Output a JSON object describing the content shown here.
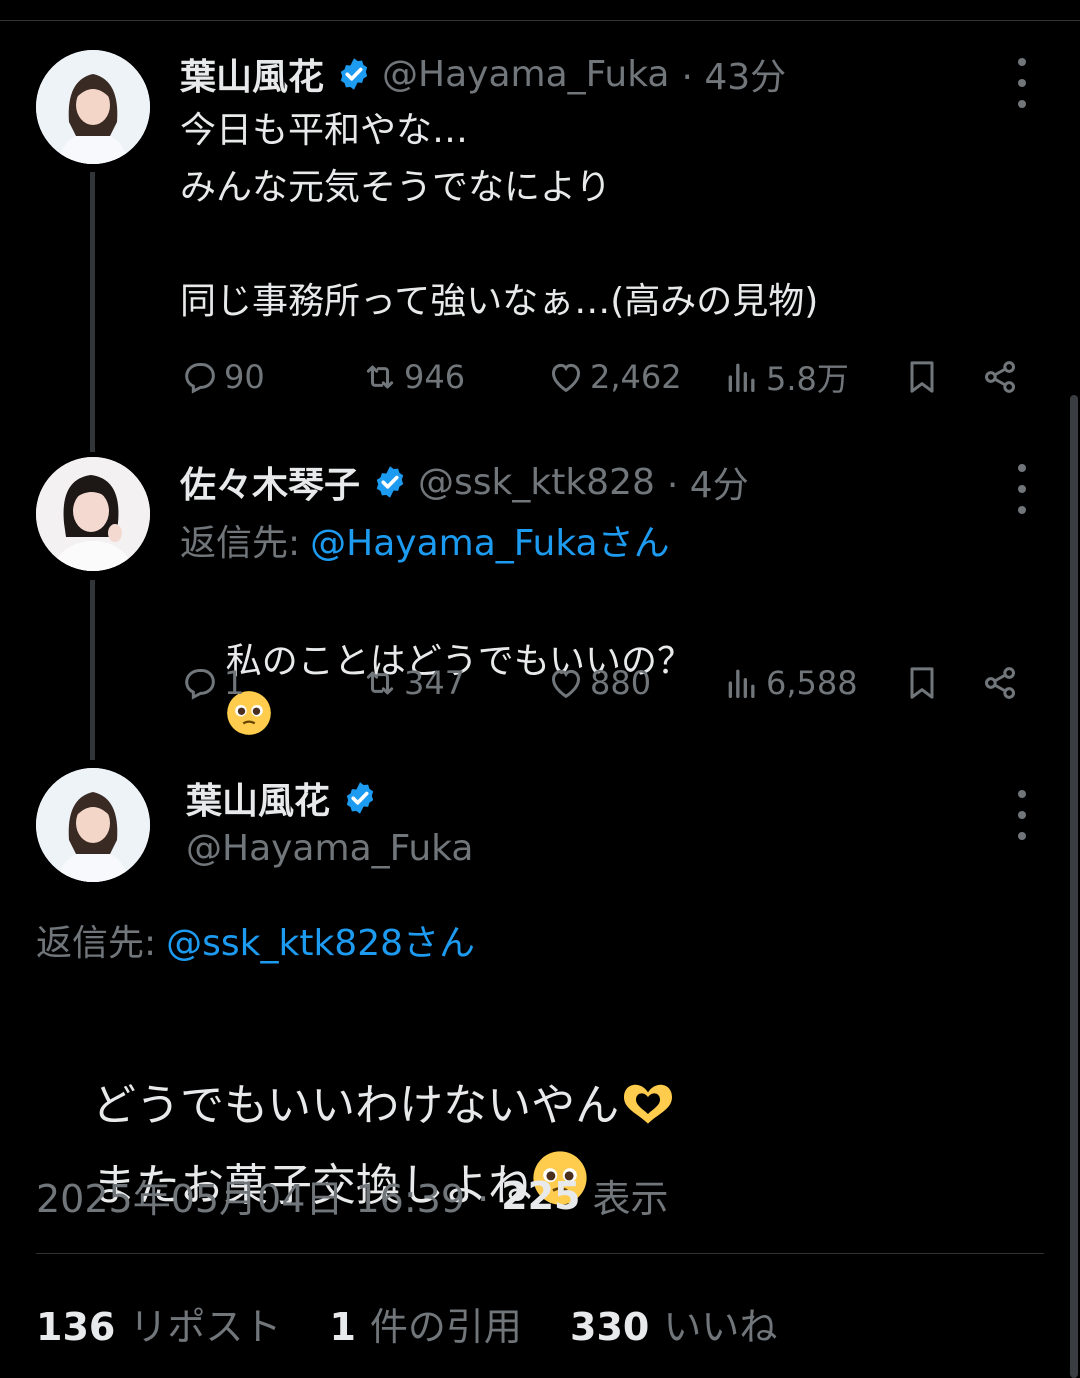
{
  "tweets": [
    {
      "name": "葉山風花",
      "handle": "@Hayama_Fuka",
      "time": "· 43分",
      "body": "今日も平和やな…\nみんな元気そうでなにより\n\n同じ事務所って強いなぁ…(高みの見物)",
      "replies": "90",
      "retweets": "946",
      "likes": "2,462",
      "views": "5.8万"
    },
    {
      "name": "佐々木琴子",
      "handle": "@ssk_ktk828",
      "time": "· 4分",
      "reply_prefix": "返信先:",
      "reply_to": "@Hayama_Fukaさん",
      "body": "私のことはどうでもいいの？",
      "replies": "1",
      "retweets": "347",
      "likes": "880",
      "views": "6,588"
    }
  ],
  "main": {
    "name": "葉山風花",
    "handle": "@Hayama_Fuka",
    "reply_prefix": "返信先:",
    "reply_to": "@ssk_ktk828さん",
    "line1": "どうでもいいわけないやん",
    "line2": "またお菓子交換しよね",
    "datetime": "2025年05月04日 16:39 ·",
    "views_count": "225",
    "views_label": "表示",
    "reposts_count": "136",
    "reposts_label": "リポスト",
    "quotes_count": "1",
    "quotes_label": "件の引用",
    "likes_count": "330",
    "likes_label": "いいね"
  },
  "icons": [
    "verified-badge-icon",
    "more-icon",
    "reply-icon",
    "retweet-icon",
    "like-icon",
    "views-icon",
    "bookmark-icon",
    "share-icon",
    "pleading-face-emoji",
    "heart-hands-emoji"
  ],
  "colors": {
    "background": "#000000",
    "text": "#e7e9ea",
    "secondary": "#71767b",
    "link": "#1d9bf0",
    "verified": "#1d9bf0"
  }
}
